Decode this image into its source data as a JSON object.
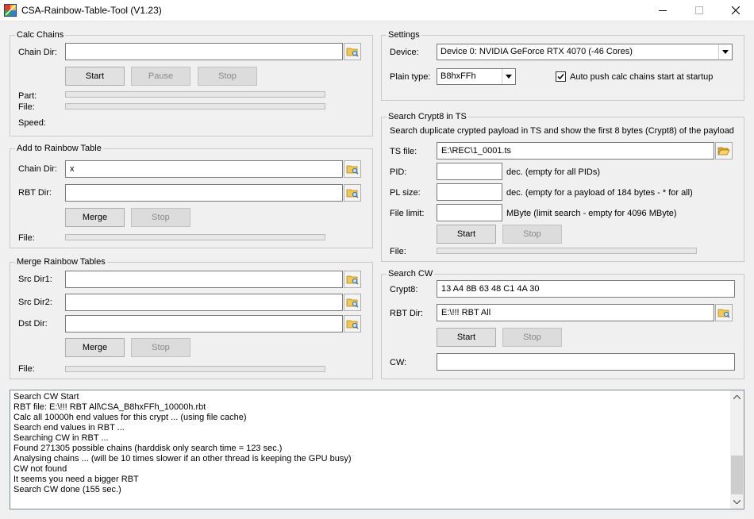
{
  "window": {
    "title": "CSA-Rainbow-Table-Tool (V1.23)"
  },
  "calc_chains": {
    "title": "Calc Chains",
    "chain_dir_label": "Chain Dir:",
    "chain_dir_value": "",
    "start_label": "Start",
    "pause_label": "Pause",
    "stop_label": "Stop",
    "part_label": "Part:",
    "file_label": "File:",
    "speed_label": "Speed:"
  },
  "add_rbt": {
    "title": "Add to Rainbow Table",
    "chain_dir_label": "Chain Dir:",
    "chain_dir_value": "x",
    "rbt_dir_label": "RBT Dir:",
    "rbt_dir_value": "",
    "merge_label": "Merge",
    "stop_label": "Stop",
    "file_label": "File:"
  },
  "merge_rbt": {
    "title": "Merge Rainbow Tables",
    "src1_label": "Src Dir1:",
    "src1_value": "",
    "src2_label": "Src Dir2:",
    "src2_value": "",
    "dst_label": "Dst Dir:",
    "dst_value": "",
    "merge_label": "Merge",
    "stop_label": "Stop",
    "file_label": "File:"
  },
  "settings": {
    "title": "Settings",
    "device_label": "Device:",
    "device_value": "Device 0: NVIDIA GeForce RTX 4070 (-46 Cores)",
    "plain_type_label": "Plain type:",
    "plain_type_value": "B8hxFFh",
    "auto_push_label": "Auto push calc chains start at startup",
    "auto_push_checked": true
  },
  "search_crypt8": {
    "title": "Search Crypt8 in TS",
    "description": "Search duplicate crypted payload in TS and show the first 8 bytes (Crypt8) of the payload",
    "ts_file_label": "TS file:",
    "ts_file_value": "E:\\REC\\1_0001.ts",
    "pid_label": "PID:",
    "pid_value": "",
    "pid_hint": "dec.   (empty for all PIDs)",
    "pl_size_label": "PL size:",
    "pl_size_value": "",
    "pl_size_hint": "dec.   (empty for a payload of 184 bytes - * for all)",
    "file_limit_label": "File limit:",
    "file_limit_value": "",
    "file_limit_hint": "MByte   (limit search - empty for 4096 MByte)",
    "start_label": "Start",
    "stop_label": "Stop",
    "file_label": "File:"
  },
  "search_cw": {
    "title": "Search CW",
    "crypt8_label": "Crypt8:",
    "crypt8_value": "13 A4 8B 63 48 C1 4A 30",
    "rbt_dir_label": "RBT Dir:",
    "rbt_dir_value": "E:\\!!! RBT All",
    "start_label": "Start",
    "stop_label": "Stop",
    "cw_label": "CW:",
    "cw_value": ""
  },
  "log": {
    "lines": [
      "Search CW Start",
      "RBT file: E:\\!!! RBT All\\CSA_B8hxFFh_10000h.rbt",
      "Calc all 10000h end values for this crypt ... (using file cache)",
      "Search end values in RBT ...",
      "Searching CW in RBT ...",
      "Found 271305 possible chains (harddisk only search time = 123 sec.)",
      "Analysing chains ... (will be 10 times slower if an other thread is keeping the GPU busy)",
      "CW not found",
      "It seems you need a bigger RBT",
      "Search CW done (155 sec.)"
    ]
  },
  "icons": {
    "app": "app-icon",
    "minimize": "minimize-icon",
    "maximize": "maximize-icon",
    "close": "close-icon",
    "browse": "folder-icon",
    "dropdown": "chevron-down-icon",
    "check": "check-icon"
  }
}
